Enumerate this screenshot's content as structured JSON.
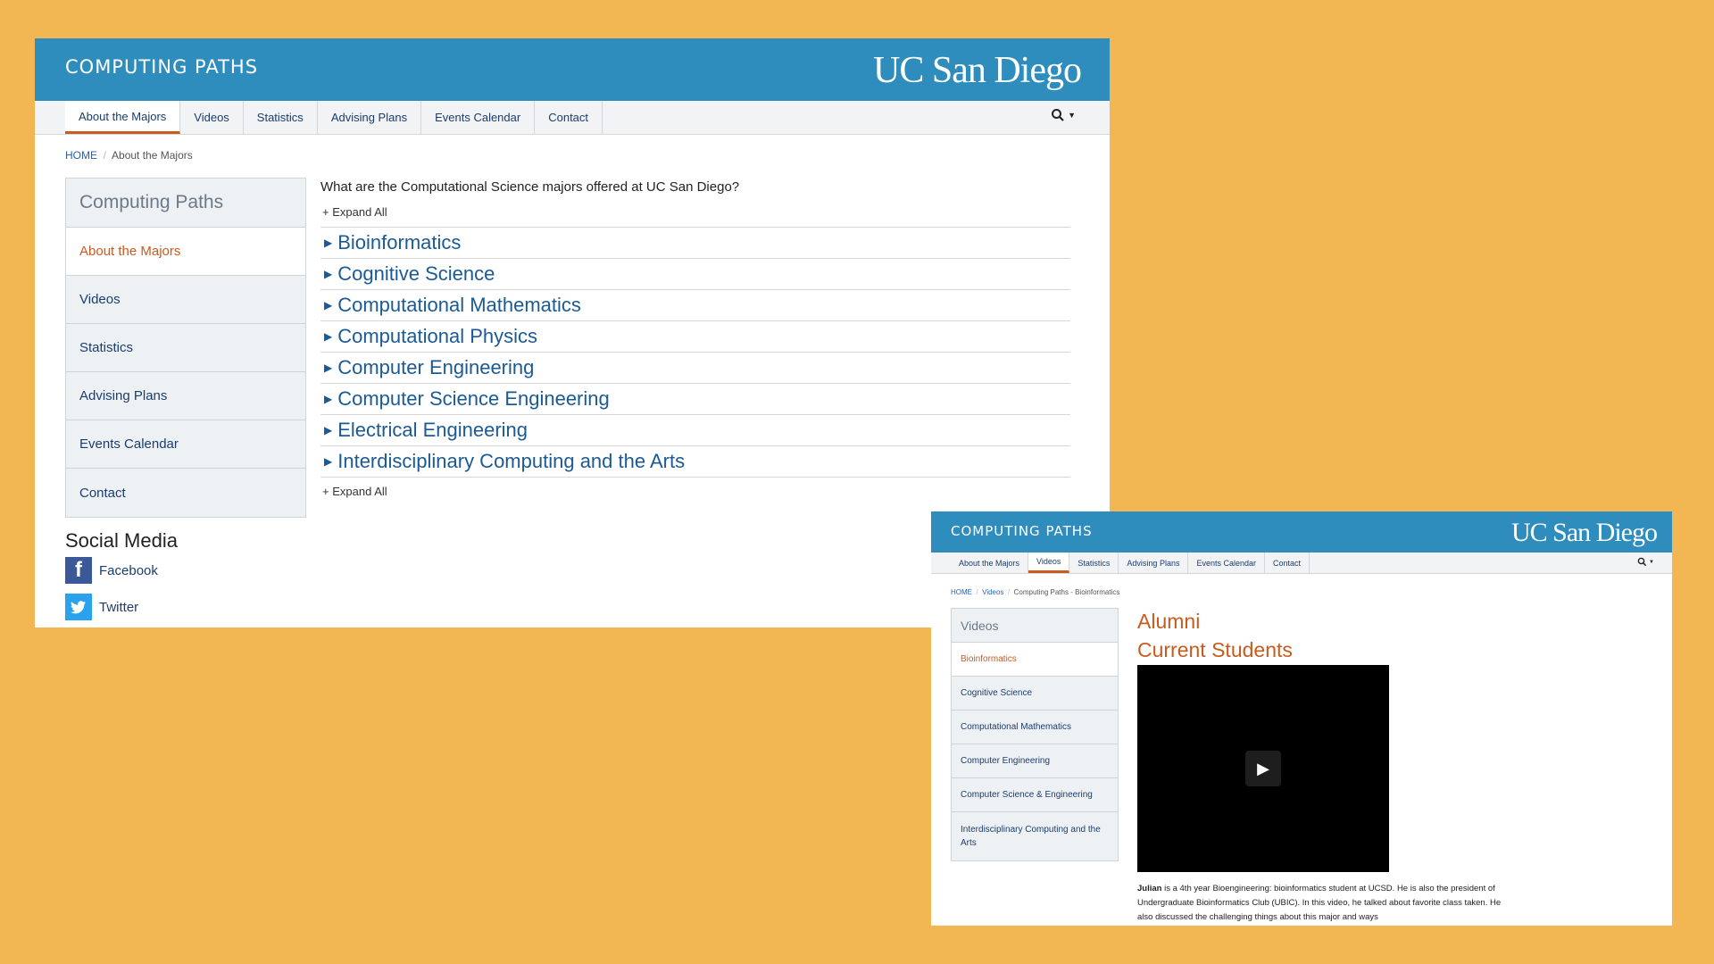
{
  "shot1": {
    "site_title": "COMPUTING PATHS",
    "logo": "UC San Diego",
    "nav": [
      "About the Majors",
      "Videos",
      "Statistics",
      "Advising Plans",
      "Events Calendar",
      "Contact"
    ],
    "search_icon": "search-icon",
    "breadcrumb": {
      "home": "HOME",
      "sep": "/",
      "current": "About the Majors"
    },
    "sidebar": {
      "heading": "Computing Paths",
      "items": [
        "About the Majors",
        "Videos",
        "Statistics",
        "Advising Plans",
        "Events Calendar",
        "Contact"
      ]
    },
    "question": "What are the Computational Science majors offered at UC San Diego?",
    "expand_all": "+ Expand All",
    "majors": [
      "Bioinformatics",
      "Cognitive Science",
      "Computational Mathematics",
      "Computational Physics",
      "Computer Engineering",
      "Computer Science Engineering",
      "Electrical Engineering",
      "Interdisciplinary Computing and the Arts"
    ],
    "social": {
      "heading": "Social Media",
      "facebook": "Facebook",
      "twitter": "Twitter"
    }
  },
  "shot2": {
    "site_title": "COMPUTING PATHS",
    "logo": "UC San Diego",
    "nav": [
      "About the Majors",
      "Videos",
      "Statistics",
      "Advising Plans",
      "Events Calendar",
      "Contact"
    ],
    "breadcrumb": {
      "home": "HOME",
      "sep1": "/",
      "videos": "Videos",
      "sep2": "/",
      "current": "Computing Paths - Bioinformatics"
    },
    "sidebar": {
      "heading": "Videos",
      "items": [
        "Bioinformatics",
        "Cognitive Science",
        "Computational Mathematics",
        "Computer Engineering",
        "Computer Science & Engineering",
        "Interdisciplinary Computing and the Arts"
      ]
    },
    "alumni": "Alumni",
    "current_students": "Current Students",
    "caption_name": "Julian",
    "caption_text": " is a 4th year Bioengineering: bioinformatics student at UCSD. He is also the president of Undergraduate Bioinformatics Club (UBIC). In this video, he talked about favorite class taken. He also discussed the challenging things about this major and ways"
  },
  "colors": {
    "background": "#f2b752",
    "banner": "#2f8dbd",
    "accent": "#c85b1e",
    "link": "#1b5a94"
  }
}
